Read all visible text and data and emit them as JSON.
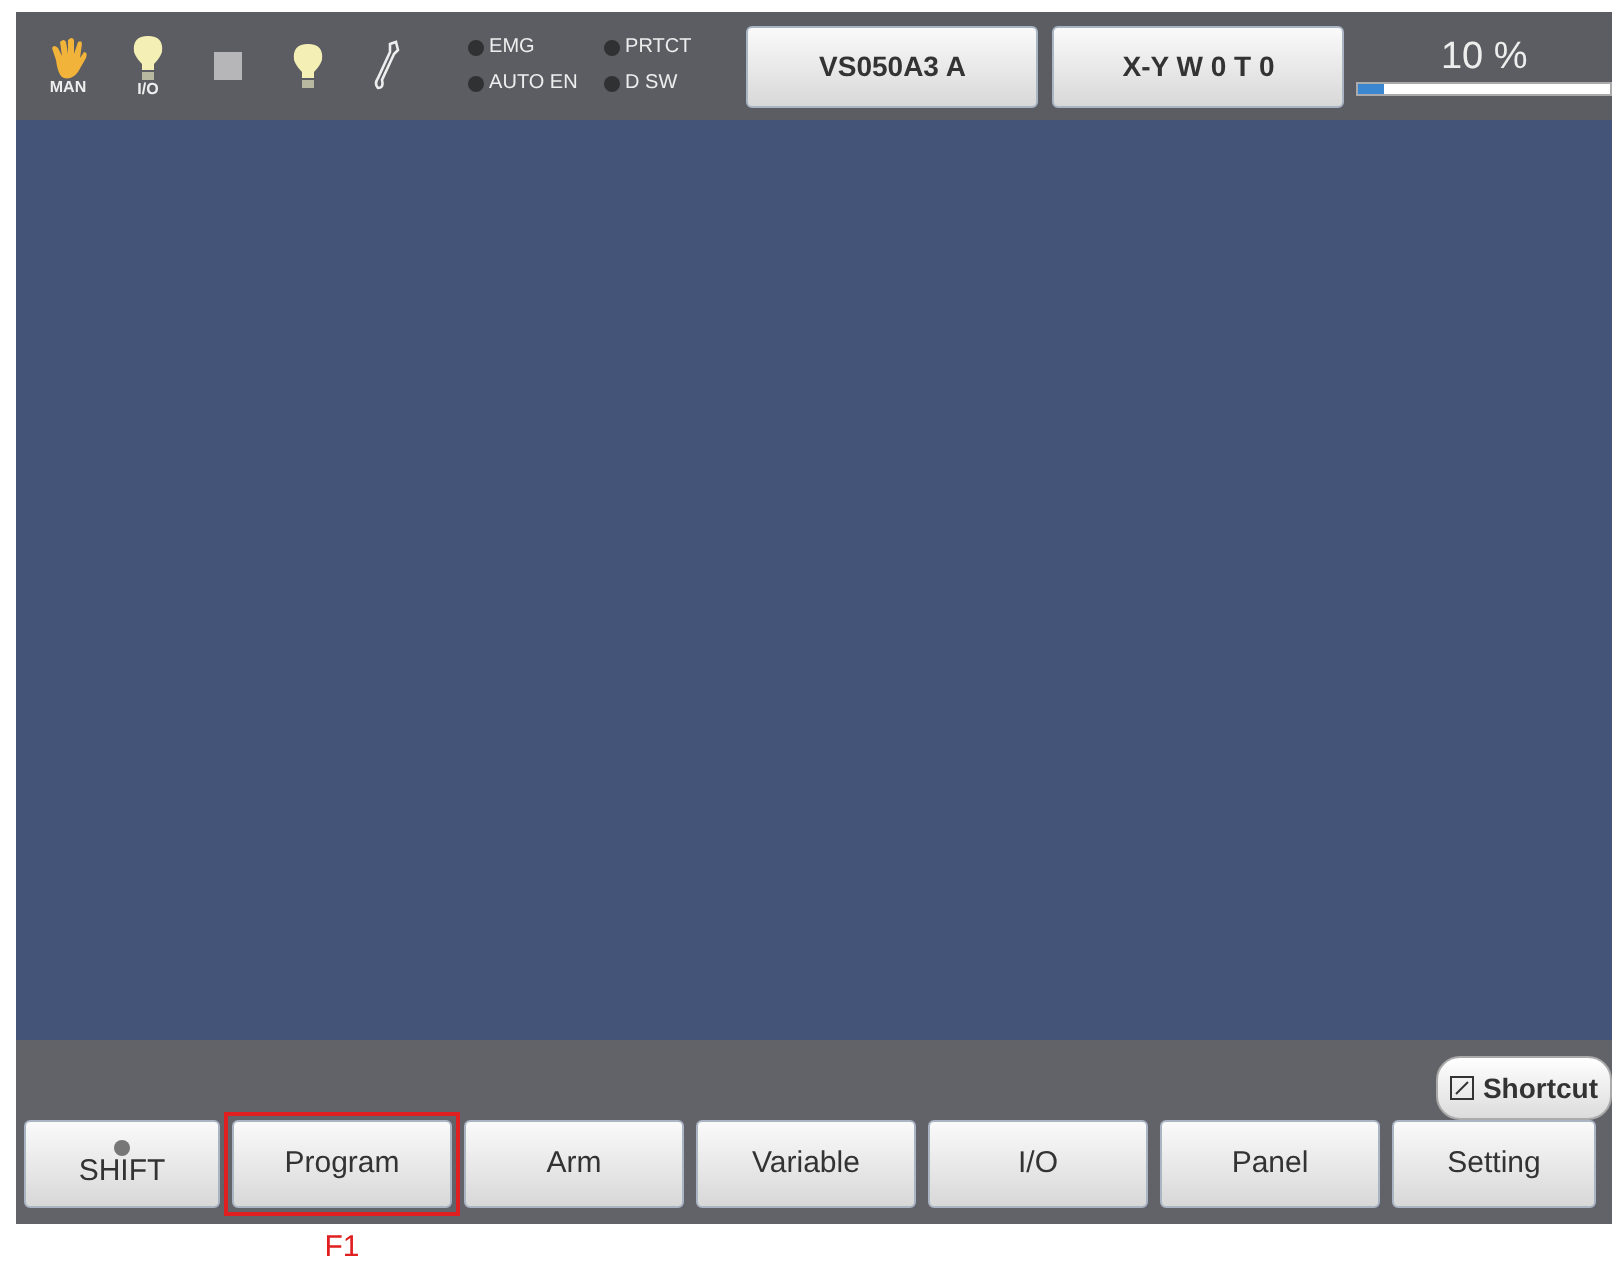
{
  "status_icons": [
    {
      "kind": "hand",
      "label": "MAN"
    },
    {
      "kind": "bulb",
      "label": "I/O"
    },
    {
      "kind": "square"
    },
    {
      "kind": "bulb"
    },
    {
      "kind": "wrench"
    }
  ],
  "indicators": [
    {
      "label": "EMG",
      "on": false
    },
    {
      "label": "PRTCT",
      "on": false
    },
    {
      "label": "AUTO EN",
      "on": false
    },
    {
      "label": "D SW",
      "on": false
    }
  ],
  "header_buttons": [
    "VS050A3 A",
    "X-Y W 0 T 0"
  ],
  "speed": {
    "reading": "10 %",
    "level": 0.1
  },
  "shortcut": "Shortcut",
  "function_buttons": [
    {
      "label": "SHIFT",
      "kind": "shift"
    },
    {
      "label": "Program",
      "kind": "plain",
      "callout": "F1"
    },
    {
      "label": "Arm",
      "kind": "plain"
    },
    {
      "label": "Variable",
      "kind": "plain"
    },
    {
      "label": "I/O",
      "kind": "plain"
    },
    {
      "label": "Panel",
      "kind": "plain"
    },
    {
      "label": "Setting",
      "kind": "plain"
    }
  ]
}
